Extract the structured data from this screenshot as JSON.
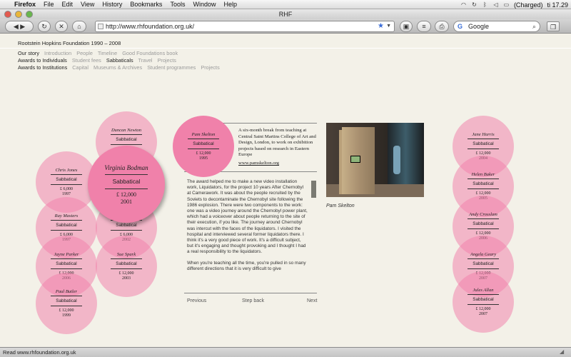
{
  "menubar": {
    "app": "Firefox",
    "items": [
      "File",
      "Edit",
      "View",
      "History",
      "Bookmarks",
      "Tools",
      "Window",
      "Help"
    ],
    "battery": "(Charged)",
    "clock": "ti 17.29"
  },
  "window": {
    "title": "RHF"
  },
  "toolbar": {
    "url": "http://www.rhfoundation.org.uk/",
    "search_placeholder": "Google"
  },
  "site": {
    "title": "Rootstein Hopkins Foundation 1990 – 2008",
    "nav": [
      {
        "head": "Our story",
        "items": [
          "Introduction",
          "People",
          "Timeline",
          "Good Foundations book"
        ]
      },
      {
        "head": "Awards to Individuals",
        "items": [
          "Student fees",
          "Sabbaticals",
          "Travel",
          "Projects"
        ],
        "active": "Sabbaticals"
      },
      {
        "head": "Awards to Institutions",
        "items": [
          "Capital",
          "Museums & Archives",
          "Student programmes",
          "Projects"
        ]
      }
    ]
  },
  "circles": {
    "duncan": {
      "name": "Duncan Newton",
      "category": "Sabbatical",
      "amount": "",
      "year": ""
    },
    "chris": {
      "name": "Chris Jones",
      "category": "Sabbatical",
      "amount": "£ 6,000",
      "year": "1997"
    },
    "virginia": {
      "name": "Virginia Bodman",
      "category": "Sabbatical",
      "amount": "£ 12,000",
      "year": "2001"
    },
    "ray": {
      "name": "Ray Masters",
      "category": "Sabbatical",
      "amount": "£ 6,000",
      "year": "1997"
    },
    "hidden2002": {
      "name": "",
      "category": "Sabbatical",
      "amount": "£ 6,000",
      "year": "2002"
    },
    "jayne": {
      "name": "Jayne Parker",
      "category": "Sabbatical",
      "amount": "£ 12,000",
      "year": "2006"
    },
    "sue": {
      "name": "Sue Spark",
      "category": "Sabbatical",
      "amount": "£ 12,000",
      "year": "2003"
    },
    "paul": {
      "name": "Paul Butler",
      "category": "Sabbatical",
      "amount": "£ 12,000",
      "year": "1999"
    },
    "pam": {
      "name": "Pam Skelton",
      "category": "Sabbatical",
      "amount": "£ 12,000",
      "year": "1995"
    },
    "jane": {
      "name": "Jane Harris",
      "category": "Sabbatical",
      "amount": "£ 12,000",
      "year": "2004"
    },
    "helen": {
      "name": "Helen Baker",
      "category": "Sabbatical",
      "amount": "£ 12,000",
      "year": "2005"
    },
    "andy": {
      "name": "Andy Crosslam",
      "category": "Sabbatical",
      "amount": "£ 12,000",
      "year": "2006"
    },
    "angela": {
      "name": "Angela Geary",
      "category": "Sabbatical",
      "amount": "£ 12,000",
      "year": "2007"
    },
    "jules": {
      "name": "Jules Allan",
      "category": "Sabbatical",
      "amount": "£ 12,000",
      "year": "2007"
    }
  },
  "detail": {
    "summary": "A six-month break from teaching at Central Saint Martins College of Art and Design, London, to work on exhibition projects based on research in Eastern Europe",
    "website": "www.pamskelton.org",
    "body1": "The award helped me to make a new video installation work, Liquidators, for the project 10 years After Chernobyl at Camerawork. It was about the people recruited by the Soviets to decontaminate the Chernobyl site following the 1986 explosion. There were two components to the work: one was a video journey around the Chernobyl power plant, which had a voiceover about people returning to the site of their execution, if you like. The journey around Chernobyl was intercut with the faces of the liquidators. I visited the hospital and interviewed several former liquidators there. I think it's a very good piece of work. It's a difficult subject, but it's engaging and thought provoking and I thought I had a real responsibility to the liquidators.",
    "body2": "When you're teaching all the time, you're pulled in so many different directions that it is very difficult to give",
    "caption": "Pam Skelton",
    "previous": "Previous",
    "step_back": "Step back",
    "next": "Next"
  },
  "status": {
    "text": "Read www.rhfoundation.org.uk"
  }
}
